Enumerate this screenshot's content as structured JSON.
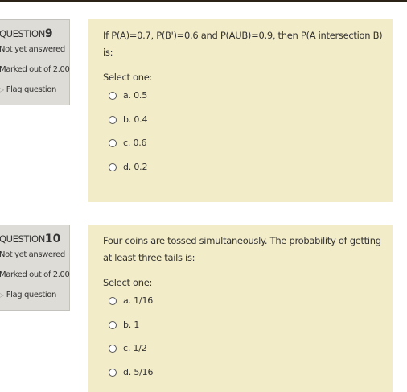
{
  "questions": [
    {
      "label": "QUESTION",
      "number": "9",
      "state": "Not yet answered",
      "grade": "Marked out of 2.00",
      "flag": "Flag question",
      "text": "If P(A)=0.7, P(B')=0.6 and P(AUB)=0.9, then P(A intersection B) is:",
      "prompt": "Select one:",
      "options": [
        "a. 0.5",
        "b. 0.4",
        "c. 0.6",
        "d. 0.2"
      ]
    },
    {
      "label": "QUESTION",
      "number": "10",
      "state": "Not yet answered",
      "grade": "Marked out of 2.00",
      "flag": "Flag question",
      "text": "Four coins are tossed simultaneously. The probability of getting at least three tails is:",
      "prompt": "Select one:",
      "options": [
        "a. 1/16",
        "b. 1",
        "c. 1/2",
        "d. 5/16"
      ]
    }
  ]
}
